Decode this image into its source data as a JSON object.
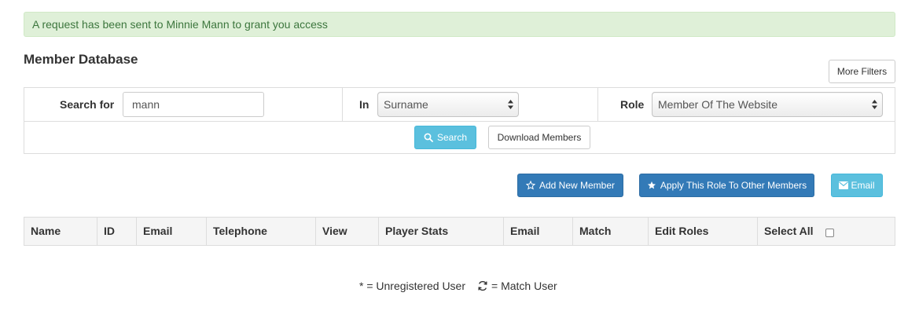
{
  "alert": {
    "message": "A request has been sent to Minnie Mann to grant you access"
  },
  "page": {
    "title": "Member Database"
  },
  "toolbar": {
    "more_filters_label": "More Filters",
    "search_label": "Search",
    "download_label": "Download Members",
    "add_member_label": "Add New Member",
    "apply_role_label": "Apply This Role To Other Members",
    "email_label": "Email"
  },
  "filters": {
    "search_for_label": "Search for",
    "search_value": "mann",
    "in_label": "In",
    "in_selected": "Surname",
    "role_label": "Role",
    "role_selected": "Member Of The Website"
  },
  "table": {
    "headers": [
      "Name",
      "ID",
      "Email",
      "Telephone",
      "View",
      "Player Stats",
      "Email",
      "Match",
      "Edit Roles",
      "Select All"
    ]
  },
  "legend": {
    "unregistered": "* = Unregistered User",
    "match": "= Match User"
  },
  "colors": {
    "alert_bg": "#dff0d8",
    "alert_text": "#3c763d",
    "primary": "#337ab7",
    "info": "#5bc0de"
  },
  "icons": {
    "search": "search-icon",
    "add_member": "star-outline-icon",
    "apply_role": "star-filled-icon",
    "email": "envelope-icon",
    "match": "refresh-icon"
  }
}
